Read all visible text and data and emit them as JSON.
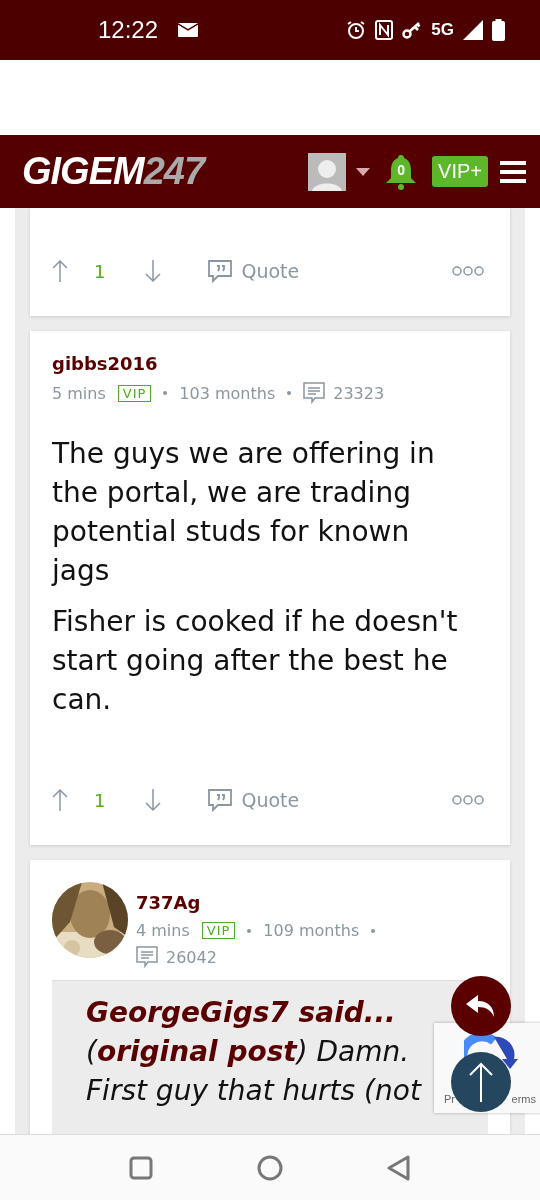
{
  "status_bar": {
    "time": "12:22",
    "network": "5G"
  },
  "header": {
    "logo": {
      "main": "GIGEM",
      "accent": "247"
    },
    "notifications": "0",
    "vip": "VIP+"
  },
  "posts": [
    {
      "kind": "tail",
      "votes": "1",
      "quote_label": "Quote"
    },
    {
      "kind": "text",
      "author": "gibbs2016",
      "time": "5 mins",
      "badge": "VIP",
      "tenure": "103 months",
      "post_count": "23323",
      "paragraphs": [
        "The guys we are offering in the portal, we are trading potential studs for known jags",
        "Fisher is cooked if he doesn't start going after the best he can."
      ],
      "votes": "1",
      "quote_label": "Quote"
    },
    {
      "kind": "quote",
      "author": "737Ag",
      "time": "4 mins",
      "badge": "VIP",
      "tenure": "109 months",
      "post_count": "26042",
      "quote": {
        "header": "GeorgeGigs7 said...",
        "body": "(**original post**) Damn. First guy that hurts (not"
      }
    }
  ],
  "recaptcha": {
    "left": "Pr",
    "right": "erms"
  }
}
